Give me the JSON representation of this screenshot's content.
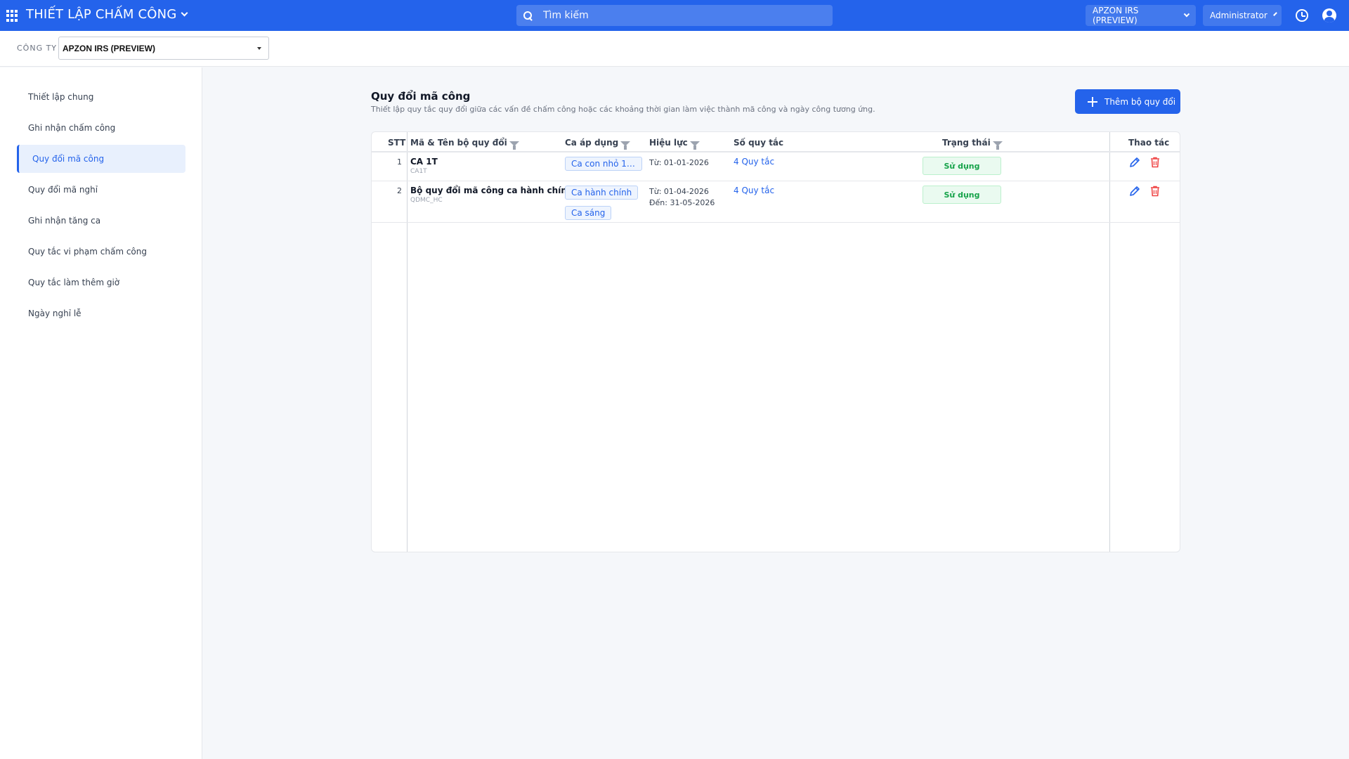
{
  "header": {
    "app_title": "THIẾT LẬP CHẤM CÔNG",
    "search_placeholder": "Tìm kiếm",
    "company_selector": "APZON IRS (PREVIEW)",
    "user": "Administrator",
    "brand_color": "#2463eb"
  },
  "company_bar": {
    "label": "CÔNG TY",
    "selected": "APZON IRS (PREVIEW)"
  },
  "sidebar": {
    "items": [
      {
        "label": "Thiết lập chung"
      },
      {
        "label": "Ghi nhận chấm công"
      },
      {
        "label": "Quy đổi mã công",
        "active": true
      },
      {
        "label": "Quy đổi mã nghỉ"
      },
      {
        "label": "Ghi nhận tăng ca"
      },
      {
        "label": "Quy tắc vi phạm chấm công"
      },
      {
        "label": "Quy tắc làm thêm giờ"
      },
      {
        "label": "Ngày nghỉ lễ"
      }
    ]
  },
  "main": {
    "title": "Quy đổi mã công",
    "description": "Thiết lập quy tắc quy đổi giữa các vấn đề chấm công hoặc các khoảng thời gian làm việc thành mã công và ngày công tương ứng.",
    "add_button": "Thêm bộ quy đổi",
    "table": {
      "columns": {
        "stt": "STT",
        "name": "Mã & Tên bộ quy đổi",
        "shift": "Ca áp dụng",
        "validity": "Hiệu lực",
        "rules": "Số quy tắc",
        "status": "Trạng thái",
        "actions": "Thao tác"
      },
      "rows": [
        {
          "stt": "1",
          "name": "CA 1T",
          "code": "CA1T",
          "shifts": [
            "Ca con nhỏ 1 t..."
          ],
          "from": "Từ: 01-01-2026",
          "to": "",
          "rules": "4 Quy tắc",
          "status": "Sử dụng"
        },
        {
          "stt": "2",
          "name": "Bộ quy đổi mã công ca hành chính",
          "code": "QDMC_HC",
          "shifts": [
            "Ca hành chính",
            "Ca sáng"
          ],
          "from": "Từ: 01-04-2026",
          "to": "Đến: 31-05-2026",
          "rules": "4 Quy tắc",
          "status": "Sử dụng"
        }
      ]
    }
  }
}
